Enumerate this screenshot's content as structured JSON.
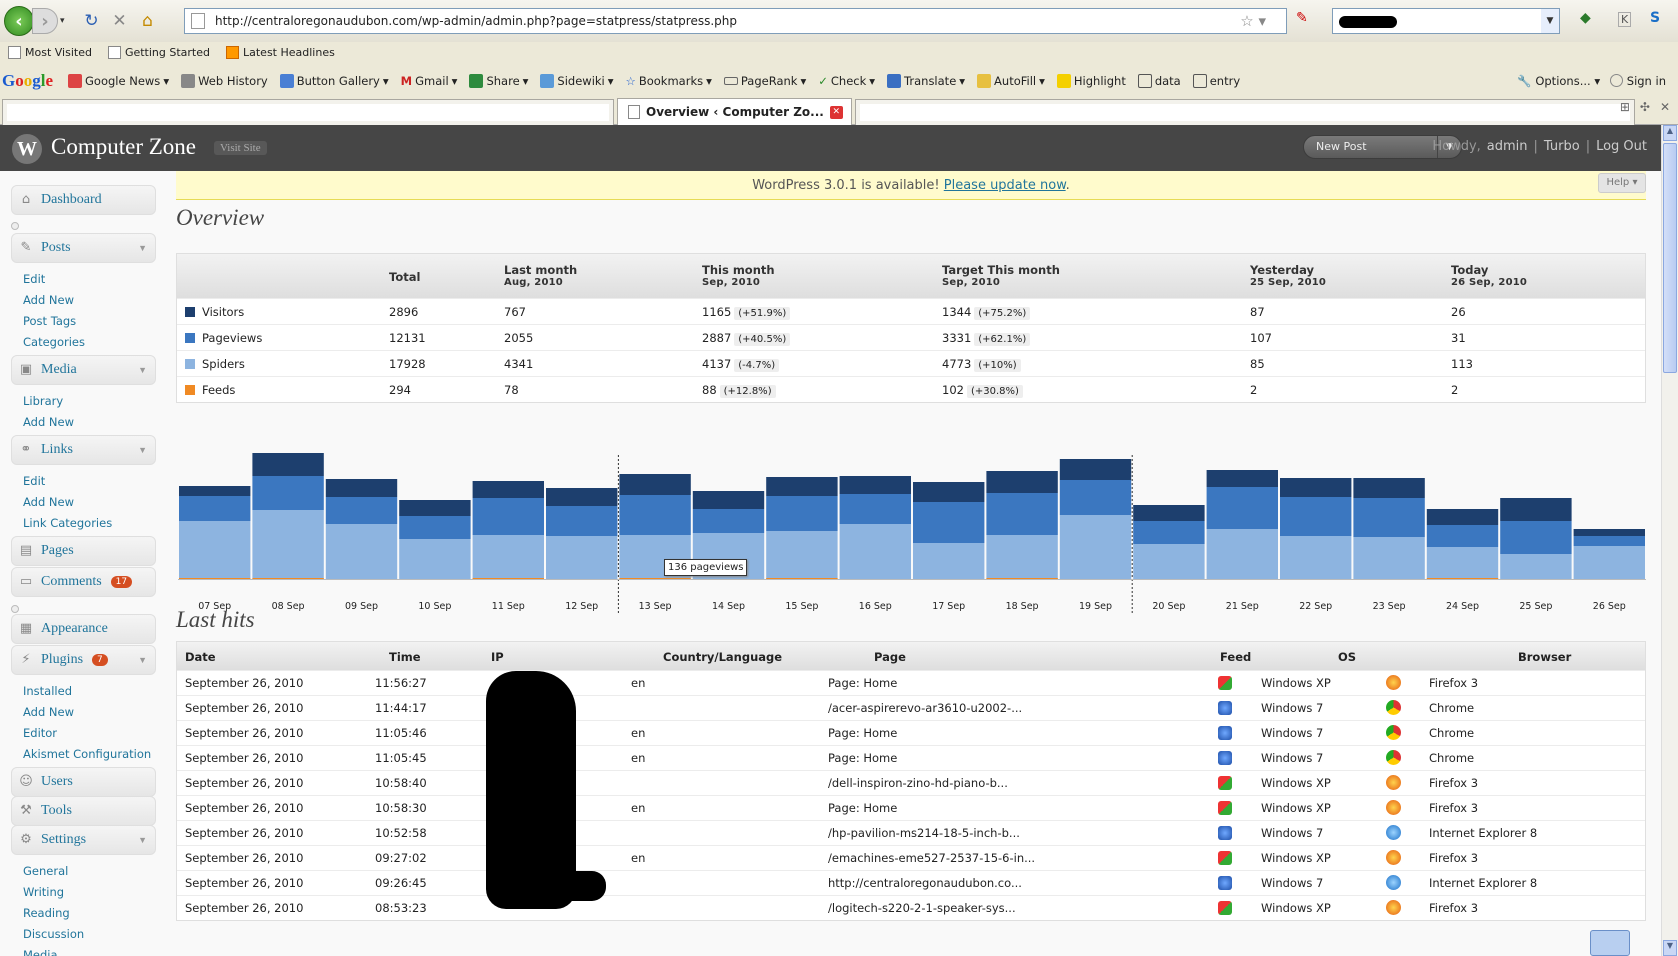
{
  "browser": {
    "url": "http://centraloregonaudubon.com/wp-admin/admin.php?page=statpress/statpress.php",
    "bookmarks": [
      "Most Visited",
      "Getting Started",
      "Latest Headlines"
    ],
    "google_logo": "Google",
    "google_toolbar": [
      "Google News",
      "Web History",
      "Button Gallery",
      "Gmail",
      "Share",
      "Sidewiki",
      "Bookmarks",
      "PageRank",
      "Check",
      "Translate",
      "AutoFill",
      "Highlight",
      "data",
      "entry"
    ],
    "google_right": [
      "Options...",
      "Sign in"
    ],
    "active_tab": "Overview ‹ Computer Zo..."
  },
  "wp": {
    "site_name": "Computer Zone",
    "visit_site": "Visit Site",
    "new_post": "New Post",
    "howdy_prefix": "Howdy,",
    "user": "admin",
    "turbo": "Turbo",
    "logout": "Log Out",
    "notice_text": "WordPress 3.0.1 is available!",
    "notice_link": "Please update now",
    "help": "Help",
    "menu": {
      "dashboard": "Dashboard",
      "posts": "Posts",
      "posts_sub": [
        "Edit",
        "Add New",
        "Post Tags",
        "Categories"
      ],
      "media": "Media",
      "media_sub": [
        "Library",
        "Add New"
      ],
      "links": "Links",
      "links_sub": [
        "Edit",
        "Add New",
        "Link Categories"
      ],
      "pages": "Pages",
      "comments": "Comments",
      "comments_badge": "17",
      "appearance": "Appearance",
      "plugins": "Plugins",
      "plugins_badge": "7",
      "plugins_sub": [
        "Installed",
        "Add New",
        "Editor",
        "Akismet Configuration"
      ],
      "users": "Users",
      "tools": "Tools",
      "settings": "Settings",
      "settings_sub": [
        "General",
        "Writing",
        "Reading",
        "Discussion",
        "Media"
      ]
    }
  },
  "overview": {
    "title": "Overview",
    "headers": [
      {
        "label": "Total",
        "sub": ""
      },
      {
        "label": "Last month",
        "sub": "Aug, 2010"
      },
      {
        "label": "This month",
        "sub": "Sep, 2010"
      },
      {
        "label": "Target This month",
        "sub": "Sep, 2010"
      },
      {
        "label": "Yesterday",
        "sub": "25 Sep, 2010"
      },
      {
        "label": "Today",
        "sub": "26 Sep, 2010"
      }
    ],
    "rows": [
      {
        "name": "Visitors",
        "color": "#1d3f6e",
        "total": "2896",
        "last": "767",
        "this": "1165",
        "this_pct": "(+51.9%)",
        "target": "1344",
        "target_pct": "(+75.2%)",
        "yesterday": "87",
        "today": "26"
      },
      {
        "name": "Pageviews",
        "color": "#3b77c0",
        "total": "12131",
        "last": "2055",
        "this": "2887",
        "this_pct": "(+40.5%)",
        "target": "3331",
        "target_pct": "(+62.1%)",
        "yesterday": "107",
        "today": "31"
      },
      {
        "name": "Spiders",
        "color": "#8db4e0",
        "total": "17928",
        "last": "4341",
        "this": "4137",
        "this_pct": "(-4.7%)",
        "target": "4773",
        "target_pct": "(+10%)",
        "yesterday": "85",
        "today": "113"
      },
      {
        "name": "Feeds",
        "color": "#f08a24",
        "total": "294",
        "last": "78",
        "this": "88",
        "this_pct": "(+12.8%)",
        "target": "102",
        "target_pct": "(+30.8%)",
        "yesterday": "2",
        "today": "2"
      }
    ]
  },
  "chart_data": {
    "type": "bar",
    "categories": [
      "07 Sep",
      "08 Sep",
      "09 Sep",
      "10 Sep",
      "11 Sep",
      "12 Sep",
      "13 Sep",
      "14 Sep",
      "15 Sep",
      "16 Sep",
      "17 Sep",
      "18 Sep",
      "19 Sep",
      "20 Sep",
      "21 Sep",
      "22 Sep",
      "23 Sep",
      "24 Sep",
      "25 Sep",
      "26 Sep"
    ],
    "series": [
      {
        "name": "Spiders",
        "color": "#8db4e0",
        "values": [
          58,
          69,
          55,
          40,
          44,
          43,
          44,
          46,
          48,
          55,
          36,
          44,
          64,
          35,
          50,
          43,
          42,
          32,
          25,
          33
        ]
      },
      {
        "name": "Pageviews",
        "color": "#3b77c0",
        "values": [
          25,
          34,
          27,
          23,
          37,
          30,
          40,
          24,
          35,
          30,
          41,
          42,
          35,
          23,
          42,
          39,
          39,
          22,
          33,
          10
        ]
      },
      {
        "name": "Visitors",
        "color": "#1d3f6e",
        "values": [
          10,
          23,
          18,
          16,
          17,
          18,
          21,
          18,
          19,
          18,
          20,
          22,
          21,
          16,
          17,
          19,
          20,
          16,
          23,
          7
        ]
      },
      {
        "name": "Feeds",
        "color": "#f08a24",
        "values": [
          1,
          1,
          0,
          0,
          1,
          0,
          1,
          0,
          1,
          0,
          0,
          1,
          0,
          0,
          0,
          0,
          0,
          1,
          0,
          0
        ]
      }
    ],
    "tooltip": "136 pageviews",
    "month_boundaries": [
      "13 Sep",
      "20 Sep"
    ]
  },
  "hits": {
    "title": "Last hits",
    "headers": [
      "Date",
      "Time",
      "IP",
      "Country/Language",
      "Page",
      "Feed",
      "OS",
      "Browser"
    ],
    "rows": [
      {
        "date": "September 26, 2010",
        "time": "11:56:27",
        "lang": "en",
        "page": "Page: Home",
        "os": "Windows XP",
        "browser": "Firefox 3"
      },
      {
        "date": "September 26, 2010",
        "time": "11:44:17",
        "lang": "",
        "page": "/acer-aspirerevo-ar3610-u2002-...",
        "os": "Windows 7",
        "browser": "Chrome"
      },
      {
        "date": "September 26, 2010",
        "time": "11:05:46",
        "lang": "en",
        "page": "Page: Home",
        "os": "Windows 7",
        "browser": "Chrome"
      },
      {
        "date": "September 26, 2010",
        "time": "11:05:45",
        "lang": "en",
        "page": "Page: Home",
        "os": "Windows 7",
        "browser": "Chrome"
      },
      {
        "date": "September 26, 2010",
        "time": "10:58:40",
        "lang": "",
        "page": "/dell-inspiron-zino-hd-piano-b...",
        "os": "Windows XP",
        "browser": "Firefox 3"
      },
      {
        "date": "September 26, 2010",
        "time": "10:58:30",
        "lang": "en",
        "page": "Page: Home",
        "os": "Windows XP",
        "browser": "Firefox 3"
      },
      {
        "date": "September 26, 2010",
        "time": "10:52:58",
        "lang": "",
        "page": "/hp-pavilion-ms214-18-5-inch-b...",
        "os": "Windows 7",
        "browser": "Internet Explorer 8"
      },
      {
        "date": "September 26, 2010",
        "time": "09:27:02",
        "lang": "en",
        "page": "/emachines-eme527-2537-15-6-in...",
        "os": "Windows XP",
        "browser": "Firefox 3"
      },
      {
        "date": "September 26, 2010",
        "time": "09:26:45",
        "lang": "",
        "page": "http://centraloregonaudubon.co...",
        "os": "Windows 7",
        "browser": "Internet Explorer 8"
      },
      {
        "date": "September 26, 2010",
        "time": "08:53:23",
        "lang": "",
        "page": "/logitech-s220-2-1-speaker-sys...",
        "os": "Windows XP",
        "browser": "Firefox 3"
      }
    ]
  }
}
